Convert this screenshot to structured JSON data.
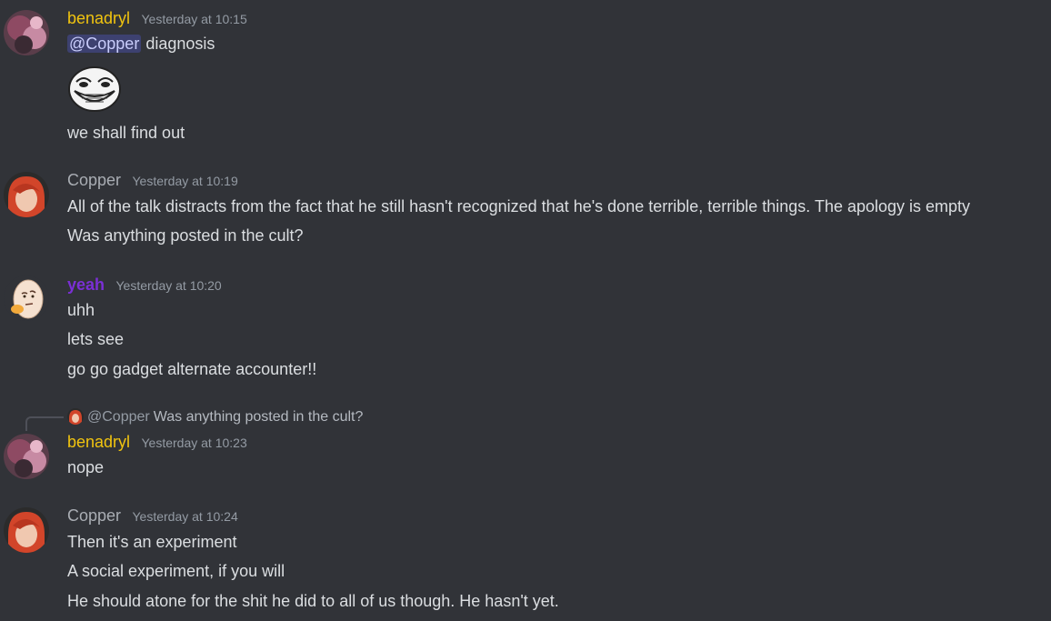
{
  "colors": {
    "background": "#313338",
    "benadryl": "#f1c40f",
    "copper": "#a9adb3",
    "yeah": "#7b2fd6",
    "timestamp": "#949ba4",
    "text": "#dbdee1",
    "mention_bg": "#45498a"
  },
  "messages": [
    {
      "user": "benadryl",
      "time": "Yesterday at 10:15",
      "avatar": "avatar-benadryl",
      "mention": "@Copper",
      "first_line_rest": " diagnosis",
      "emoji": "trollface-emoji",
      "lines": [
        "we shall find out"
      ]
    },
    {
      "user": "Copper",
      "time": "Yesterday at 10:19",
      "avatar": "avatar-copper",
      "lines": [
        "All of the talk distracts from the fact that he still hasn't recognized that he's done terrible, terrible things. The apology is empty",
        "Was anything posted in the cult?"
      ]
    },
    {
      "user": "yeah",
      "time": "Yesterday at 10:20",
      "avatar": "avatar-thinking-egg",
      "lines": [
        "uhh",
        "lets see",
        "go go gadget alternate accounter!!"
      ]
    },
    {
      "reply": {
        "user": "@Copper",
        "text": "Was anything posted in the cult?"
      },
      "user": "benadryl",
      "time": "Yesterday at 10:23",
      "avatar": "avatar-benadryl",
      "lines": [
        "nope"
      ]
    },
    {
      "user": "Copper",
      "time": "Yesterday at 10:24",
      "avatar": "avatar-copper",
      "lines": [
        "Then it's an experiment",
        "A social experiment, if you will",
        "He should atone for the shit he did to all of us though. He hasn't yet."
      ]
    }
  ]
}
